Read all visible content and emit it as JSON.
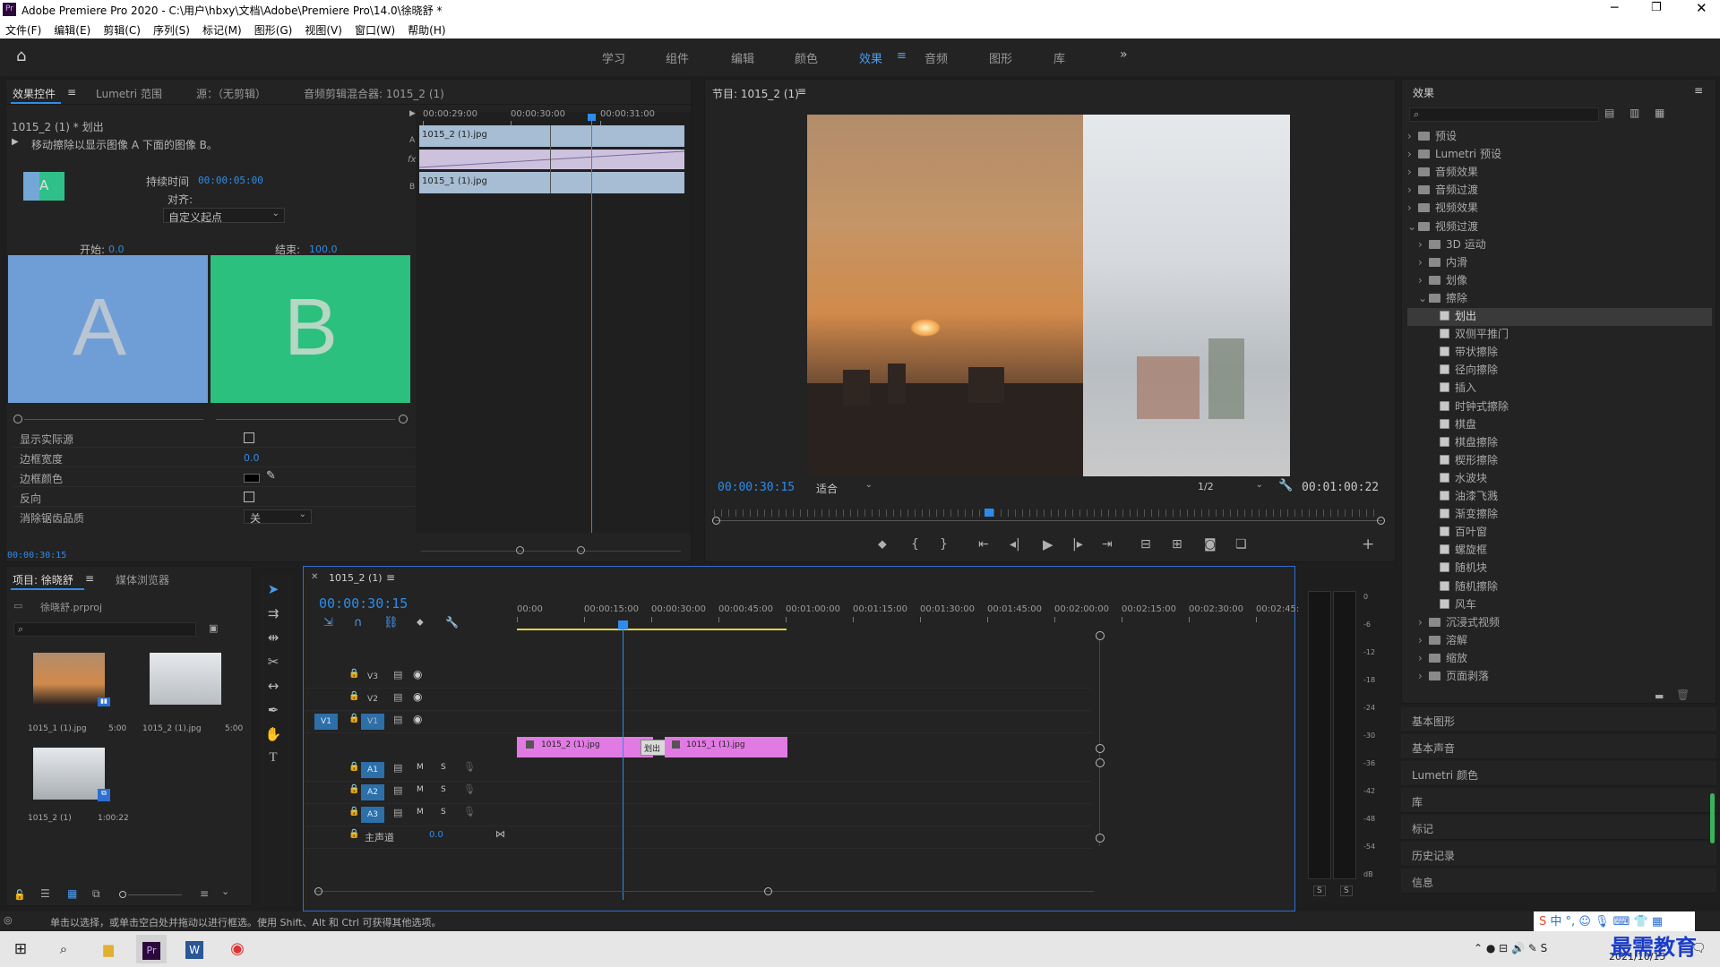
{
  "window": {
    "title": "Adobe Premiere Pro 2020 - C:\\用户\\hbxy\\文档\\Adobe\\Premiere Pro\\14.0\\徐晓舒 *"
  },
  "menu": [
    "文件(F)",
    "编辑(E)",
    "剪辑(C)",
    "序列(S)",
    "标记(M)",
    "图形(G)",
    "视图(V)",
    "窗口(W)",
    "帮助(H)"
  ],
  "workspaces": [
    "学习",
    "组件",
    "编辑",
    "颜色",
    "效果",
    "音频",
    "图形",
    "库"
  ],
  "workspace_active": "效果",
  "effect_controls": {
    "tabs": [
      "效果控件",
      "Lumetri 范围",
      "源：（无剪辑）",
      "音频剪辑混合器: 1015_2 (1)"
    ],
    "clip_label": "1015_2 (1) * 划出",
    "description": "移动擦除以显示图像 A 下面的图像 B。",
    "duration_label": "持续时间",
    "duration": "00:00:05:00",
    "align_label": "对齐:",
    "align_value": "自定义起点",
    "start_label": "开始:",
    "start_value": "0.0",
    "end_label": "结束:",
    "end_value": "100.0",
    "a_letter": "A",
    "b_letter": "B",
    "mini_timecodes": [
      "00:00:29:00",
      "00:00:30:00",
      "00:00:31:00"
    ],
    "mini_clip_a": "1015_2 (1).jpg",
    "mini_clip_b": "1015_1 (1).jpg",
    "track_a": "A",
    "track_b": "B",
    "fx_icon": "fx",
    "props": [
      {
        "label": "显示实际源",
        "value": ""
      },
      {
        "label": "边框宽度",
        "value": "0.0"
      },
      {
        "label": "边框颜色",
        "value": ""
      },
      {
        "label": "反向",
        "value": ""
      },
      {
        "label": "消除锯齿品质",
        "value": "关"
      }
    ],
    "current_time": "00:00:30:15"
  },
  "program_monitor": {
    "title": "节目: 1015_2 (1)",
    "timecode": "00:00:30:15",
    "fit": "适合",
    "resolution": "1/2",
    "duration": "00:01:00:22"
  },
  "project": {
    "tabs": [
      "项目: 徐晓舒",
      "媒体浏览器"
    ],
    "file": "徐晓舒.prproj",
    "items": [
      {
        "name": "1015_1 (1).jpg",
        "dur": "5:00"
      },
      {
        "name": "1015_2 (1).jpg",
        "dur": "5:00"
      },
      {
        "name": "1015_2 (1)",
        "dur": "1:00:22"
      }
    ]
  },
  "timeline": {
    "tab": "1015_2 (1)",
    "timecode": "00:00:30:15",
    "ruler": [
      "00:00",
      "00:00:15:00",
      "00:00:30:00",
      "00:00:45:00",
      "00:01:00:00",
      "00:01:15:00",
      "00:01:30:00",
      "00:01:45:00",
      "00:02:00:00",
      "00:02:15:00",
      "00:02:30:00",
      "00:02:45:"
    ],
    "video_tracks": [
      "V3",
      "V2",
      "V1"
    ],
    "audio_tracks": [
      "A1",
      "A2",
      "A3"
    ],
    "source_v1": "V1",
    "master_label": "主声道",
    "master_value": "0.0",
    "clip1": "1015_2 (1).jpg",
    "clip2": "1015_1 (1).jpg",
    "transition": "划出",
    "m": "M",
    "s": "S"
  },
  "meter_labels": [
    "0",
    "-6",
    "-12",
    "-18",
    "-24",
    "-30",
    "-36",
    "-42",
    "-48",
    "-54",
    "dB"
  ],
  "effects_panel": {
    "title": "效果",
    "tree": [
      {
        "label": "预设",
        "level": 0,
        "type": "folder",
        "open": false
      },
      {
        "label": "Lumetri 预设",
        "level": 0,
        "type": "folder",
        "open": false
      },
      {
        "label": "音频效果",
        "level": 0,
        "type": "folder",
        "open": false
      },
      {
        "label": "音频过渡",
        "level": 0,
        "type": "folder",
        "open": false
      },
      {
        "label": "视频效果",
        "level": 0,
        "type": "folder",
        "open": false
      },
      {
        "label": "视频过渡",
        "level": 0,
        "type": "folder",
        "open": true
      },
      {
        "label": "3D 运动",
        "level": 1,
        "type": "folder",
        "open": false
      },
      {
        "label": "内滑",
        "level": 1,
        "type": "folder",
        "open": false
      },
      {
        "label": "划像",
        "level": 1,
        "type": "folder",
        "open": false
      },
      {
        "label": "擦除",
        "level": 1,
        "type": "folder",
        "open": true
      },
      {
        "label": "划出",
        "level": 2,
        "type": "fx",
        "selected": true
      },
      {
        "label": "双侧平推门",
        "level": 2,
        "type": "fx"
      },
      {
        "label": "带状擦除",
        "level": 2,
        "type": "fx"
      },
      {
        "label": "径向擦除",
        "level": 2,
        "type": "fx"
      },
      {
        "label": "插入",
        "level": 2,
        "type": "fx"
      },
      {
        "label": "时钟式擦除",
        "level": 2,
        "type": "fx"
      },
      {
        "label": "棋盘",
        "level": 2,
        "type": "fx"
      },
      {
        "label": "棋盘擦除",
        "level": 2,
        "type": "fx"
      },
      {
        "label": "楔形擦除",
        "level": 2,
        "type": "fx"
      },
      {
        "label": "水波块",
        "level": 2,
        "type": "fx"
      },
      {
        "label": "油漆飞溅",
        "level": 2,
        "type": "fx"
      },
      {
        "label": "渐变擦除",
        "level": 2,
        "type": "fx"
      },
      {
        "label": "百叶窗",
        "level": 2,
        "type": "fx"
      },
      {
        "label": "螺旋框",
        "level": 2,
        "type": "fx"
      },
      {
        "label": "随机块",
        "level": 2,
        "type": "fx"
      },
      {
        "label": "随机擦除",
        "level": 2,
        "type": "fx"
      },
      {
        "label": "风车",
        "level": 2,
        "type": "fx"
      },
      {
        "label": "沉浸式视频",
        "level": 1,
        "type": "folder",
        "open": false
      },
      {
        "label": "溶解",
        "level": 1,
        "type": "folder",
        "open": false
      },
      {
        "label": "缩放",
        "level": 1,
        "type": "folder",
        "open": false
      },
      {
        "label": "页面剥落",
        "level": 1,
        "type": "folder",
        "open": false
      }
    ],
    "sections": [
      "基本图形",
      "基本声音",
      "Lumetri 颜色",
      "库",
      "标记",
      "历史记录",
      "信息"
    ]
  },
  "status_bar": "单击以选择，或单击空白处并拖动以进行框选。使用 Shift、Alt 和 Ctrl 可获得其他选项。",
  "taskbar": {
    "time": "2021/10/15",
    "watermark": "最需教育",
    "ime": "中"
  }
}
